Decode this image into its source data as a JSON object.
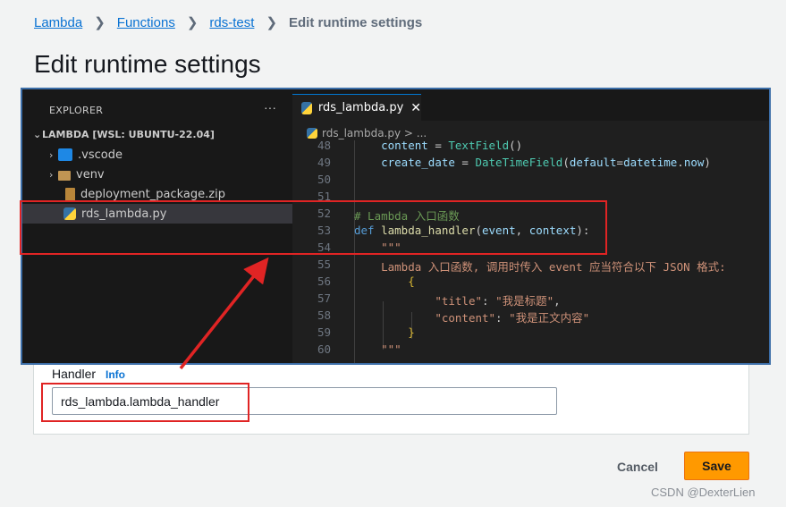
{
  "breadcrumb": {
    "items": [
      "Lambda",
      "Functions",
      "rds-test"
    ],
    "current": "Edit runtime settings",
    "separator": "❯"
  },
  "page_title": "Edit runtime settings",
  "handler": {
    "label": "Handler",
    "info": "Info",
    "value": "rds_lambda.lambda_handler"
  },
  "actions": {
    "cancel": "Cancel",
    "save": "Save"
  },
  "watermark": "CSDN @DexterLien",
  "vscode": {
    "explorer_title": "EXPLORER",
    "more": "···",
    "workspace": "LAMBDA [WSL: UBUNTU-22.04]",
    "files": [
      {
        "name": ".vscode",
        "icon": "vscode-folder-icon"
      },
      {
        "name": "venv",
        "icon": "folder-icon"
      },
      {
        "name": "deployment_package.zip",
        "icon": "zip-icon"
      },
      {
        "name": "rds_lambda.py",
        "icon": "python-icon"
      }
    ],
    "tab": {
      "name": "rds_lambda.py",
      "close": "✕"
    },
    "breadcrumb": "rds_lambda.py > ...",
    "code": [
      {
        "ln": "48",
        "text": "    content = TextField()"
      },
      {
        "ln": "49",
        "text": "    create_date = DateTimeField(default=datetime.now)"
      },
      {
        "ln": "50",
        "text": ""
      },
      {
        "ln": "51",
        "text": ""
      },
      {
        "ln": "52",
        "text": "# Lambda 入口函数"
      },
      {
        "ln": "53",
        "text": "def lambda_handler(event, context):"
      },
      {
        "ln": "54",
        "text": "    \"\"\""
      },
      {
        "ln": "55",
        "text": "    Lambda 入口函数, 调用时传入 event 应当符合以下 JSON 格式:"
      },
      {
        "ln": "56",
        "text": "        {"
      },
      {
        "ln": "57",
        "text": "            \"title\": \"我是标题\","
      },
      {
        "ln": "58",
        "text": "            \"content\": \"我是正文内容\""
      },
      {
        "ln": "59",
        "text": "        }"
      },
      {
        "ln": "60",
        "text": "    \"\"\""
      }
    ]
  },
  "colors": {
    "accent": "#0972d3",
    "save": "#ff9900",
    "annotation": "#e02424",
    "keyword": "#569cd6",
    "function": "#dcdcaa",
    "variable": "#9cdcfe",
    "class": "#4ec9b0",
    "string": "#ce9178",
    "comment": "#6a9955"
  }
}
